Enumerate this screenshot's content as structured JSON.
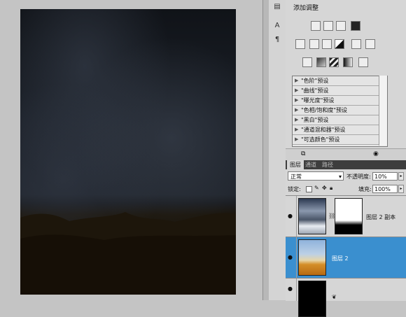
{
  "adjustments": {
    "title": "添加调整",
    "presets": [
      "\"色阶\"预设",
      "\"曲线\"预设",
      "\"曝光度\"预设",
      "\"色相/饱和度\"预设",
      "\"黑白\"预设",
      "\"通道混和器\"预设",
      "\"可选颜色\"预设"
    ]
  },
  "layers_panel": {
    "tabs": [
      "图层",
      "通道",
      "路径"
    ],
    "blend_mode": "正常",
    "opacity_label": "不透明度:",
    "opacity_value": "10%",
    "lock_label": "锁定:",
    "fill_label": "填充:",
    "fill_value": "100%",
    "layers": [
      {
        "name": "图层 2 副本",
        "selected": false
      },
      {
        "name": "图层 2",
        "selected": true
      },
      {
        "name": "",
        "selected": false
      }
    ]
  },
  "colors": {
    "selection": "#3a8fcf",
    "panel_bg": "#d6d6d6",
    "canvas_bg": "#c4c4c4"
  },
  "icons": [
    "brightness-icon",
    "levels-icon",
    "curves-icon",
    "exposure-icon",
    "vibrance-icon",
    "hue-saturation-icon",
    "color-balance-icon",
    "black-white-icon",
    "photo-filter-icon",
    "channel-mixer-icon",
    "invert-icon",
    "posterize-icon",
    "threshold-icon",
    "gradient-map-icon",
    "selective-color-icon",
    "eye-icon",
    "link-icon",
    "lock-icon"
  ]
}
